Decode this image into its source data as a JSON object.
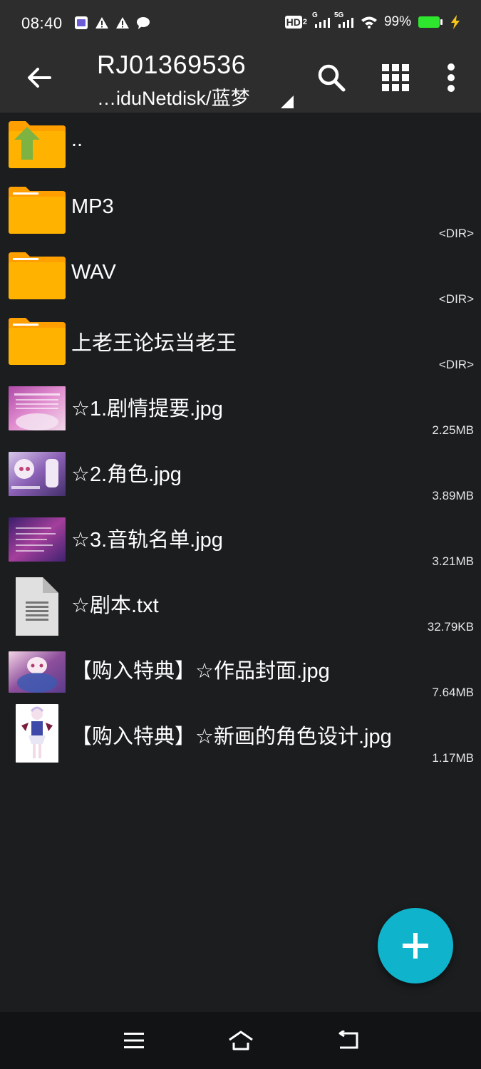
{
  "status_bar": {
    "time": "08:40",
    "battery": "99%",
    "net_1": "G",
    "net_2": "5G",
    "hd_label": "HD",
    "hd_sub": "2",
    "icons": [
      "app-notification-icon",
      "warning-icon",
      "warning-icon",
      "chat-bubble-icon",
      "signal-icon",
      "signal-icon",
      "wifi-icon",
      "battery-icon",
      "charging-icon"
    ]
  },
  "toolbar": {
    "title": "RJ01369536",
    "path": "…iduNetdisk/蓝梦",
    "icons": [
      "back-arrow-icon",
      "search-icon",
      "grid-view-icon",
      "more-vert-icon"
    ]
  },
  "files": [
    {
      "name": "..",
      "meta": "",
      "type": "parent"
    },
    {
      "name": "MP3",
      "meta": "<DIR>",
      "type": "folder"
    },
    {
      "name": "WAV",
      "meta": "<DIR>",
      "type": "folder"
    },
    {
      "name": "上老王论坛当老王",
      "meta": "<DIR>",
      "type": "folder"
    },
    {
      "name": "☆1.剧情提要.jpg",
      "meta": "2.25MB",
      "type": "image"
    },
    {
      "name": "☆2.角色.jpg",
      "meta": "3.89MB",
      "type": "image"
    },
    {
      "name": "☆3.音轨名单.jpg",
      "meta": "3.21MB",
      "type": "image"
    },
    {
      "name": "☆剧本.txt",
      "meta": "32.79KB",
      "type": "text"
    },
    {
      "name": "【购入特典】☆作品封面.jpg",
      "meta": "7.64MB",
      "type": "image"
    },
    {
      "name": "【购入特典】☆新画的角色设计.jpg",
      "meta": "1.17MB",
      "type": "image"
    }
  ],
  "fab": {
    "icon": "plus-icon"
  },
  "nav_bar": {
    "icons": [
      "menu-icon",
      "home-icon",
      "back-icon"
    ]
  },
  "colors": {
    "background": "#1b1d1f",
    "toolbar": "#2d2d2d",
    "folder": "#ffa000",
    "fab": "#0fb3cc",
    "battery": "#2ee62e"
  }
}
